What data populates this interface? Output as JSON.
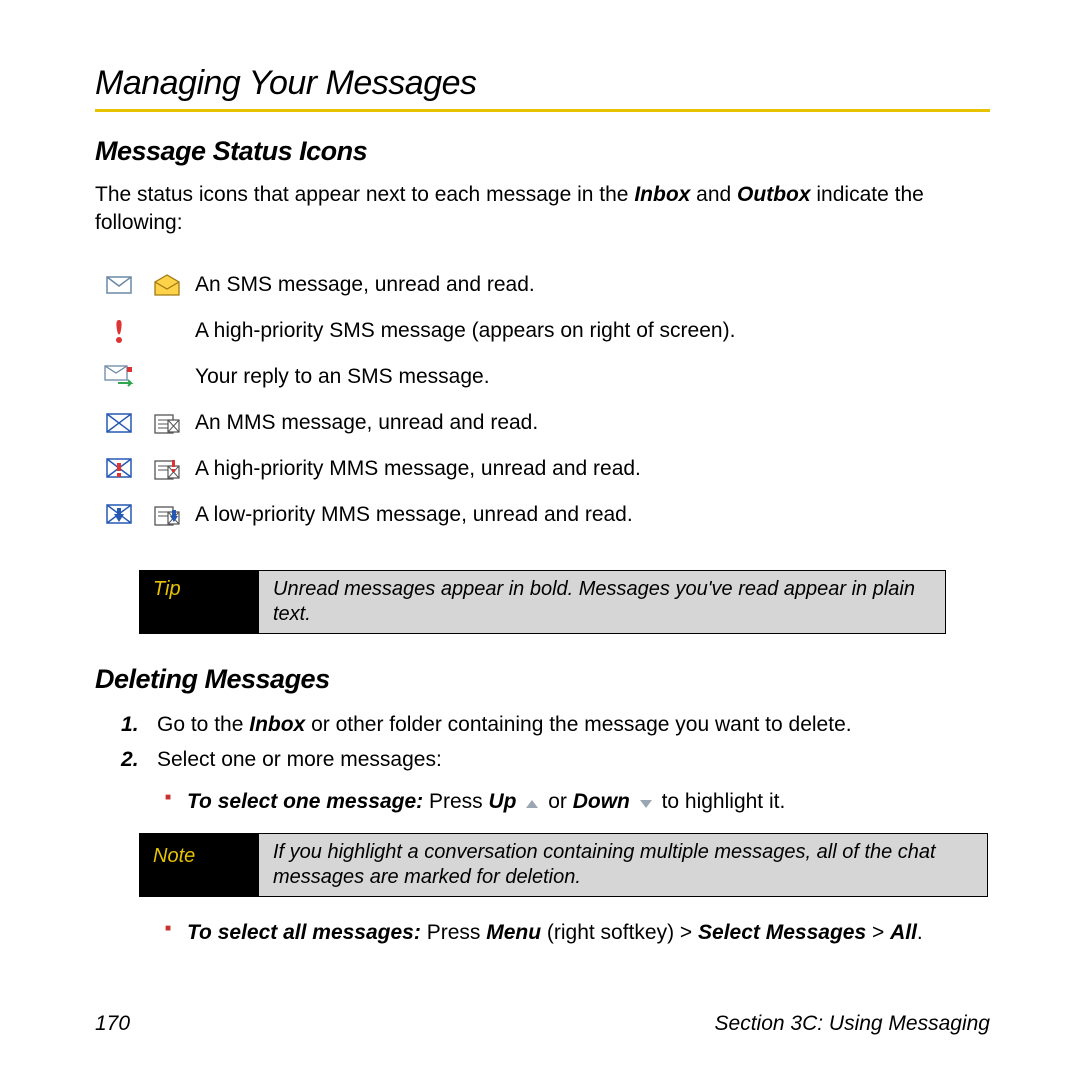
{
  "title": "Managing Your Messages",
  "section_status": {
    "heading": "Message Status Icons",
    "intro_parts": {
      "pre": "The status icons that appear next to each message in the ",
      "inbox": "Inbox",
      "mid": " and ",
      "outbox": "Outbox",
      "post": " indicate the following:"
    },
    "rows": [
      {
        "desc": "An SMS message, unread and read."
      },
      {
        "desc": "A high-priority SMS message (appears on right of screen)."
      },
      {
        "desc": "Your reply to an SMS message."
      },
      {
        "desc": "An MMS message, unread and read."
      },
      {
        "desc": "A high-priority MMS message, unread and read."
      },
      {
        "desc": "A low-priority MMS message, unread and read."
      }
    ]
  },
  "tip": {
    "label": "Tip",
    "body": "Unread messages appear in bold. Messages you've read appear in plain text."
  },
  "section_delete": {
    "heading": "Deleting Messages",
    "step1": {
      "pre": "Go to the ",
      "inbox": "Inbox",
      "post": " or other folder containing the message you want to delete."
    },
    "step2": "Select one or more messages:",
    "sub1": {
      "bold": "To select one message:",
      "press": " Press ",
      "up": "Up",
      "or": " or ",
      "down": "Down",
      "tail": " to highlight it."
    },
    "sub2": {
      "bold": "To select all messages:",
      "press": " Press ",
      "menu": "Menu",
      "soft": " (right softkey) ",
      "gt1": ">",
      "sel": " Select Messages ",
      "gt2": ">",
      "all": " All",
      "dot": "."
    }
  },
  "note": {
    "label": "Note",
    "body": "If you highlight a conversation containing multiple messages, all of the chat messages are marked for deletion."
  },
  "footer": {
    "page": "170",
    "section": "Section 3C: Using Messaging"
  }
}
